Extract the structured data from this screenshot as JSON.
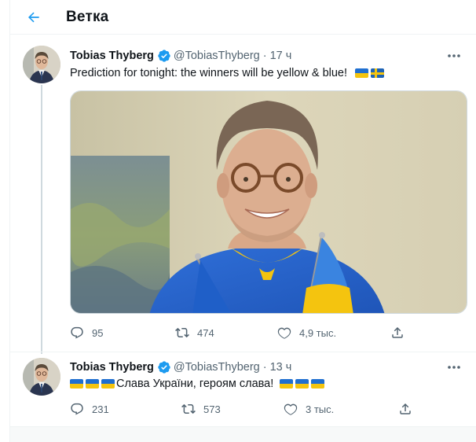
{
  "header": {
    "title": "Ветка",
    "back_icon": "arrow-left-icon",
    "accent_color": "#1d9bf0"
  },
  "tweets": [
    {
      "author_name": "Tobias Thyberg",
      "verified": true,
      "handle": "@TobiasThyberg",
      "separator": "·",
      "time": "17 ч",
      "text": "Prediction for tonight: the winners will be yellow & blue!",
      "text_emoji": [
        "flag-ukraine",
        "flag-sweden"
      ],
      "has_media": true,
      "media_description": "man-wearing-ukraine-jersey-with-flags",
      "actions": {
        "reply_count": "95",
        "retweet_count": "474",
        "like_count": "4,9 тыс."
      }
    },
    {
      "author_name": "Tobias Thyberg",
      "verified": true,
      "handle": "@TobiasThyberg",
      "separator": "·",
      "time": "13 ч",
      "text": "Слава України, героям слава!",
      "text_emoji_before": [
        "flag-ukraine",
        "flag-ukraine",
        "flag-ukraine"
      ],
      "text_emoji_after": [
        "flag-ukraine",
        "flag-ukraine",
        "flag-ukraine"
      ],
      "actions": {
        "reply_count": "231",
        "retweet_count": "573",
        "like_count": "3 тыс."
      }
    }
  ],
  "colors": {
    "text_primary": "#0f1419",
    "text_secondary": "#536471",
    "verified_blue": "#1d9bf0",
    "flag_blue": "#1f6fd0",
    "flag_yellow": "#f4c40f"
  }
}
